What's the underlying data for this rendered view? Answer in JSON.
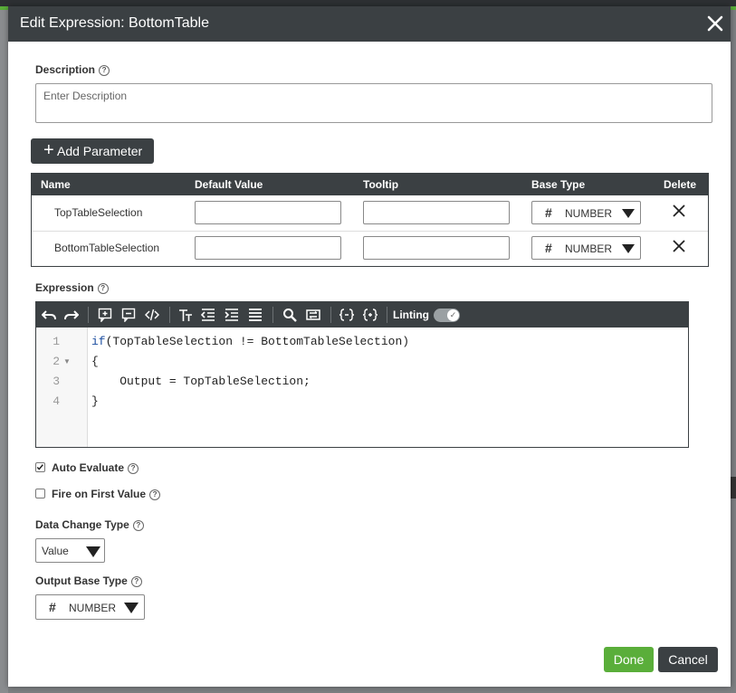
{
  "dialog": {
    "title": "Edit Expression: BottomTable"
  },
  "description": {
    "label": "Description",
    "placeholder": "Enter Description",
    "value": ""
  },
  "add_parameter_label": "Add Parameter",
  "parameters": {
    "columns": [
      "Name",
      "Default Value",
      "Tooltip",
      "Base Type",
      "Delete"
    ],
    "rows": [
      {
        "name": "TopTableSelection",
        "default_value": "",
        "tooltip": "",
        "base_type": "NUMBER"
      },
      {
        "name": "BottomTableSelection",
        "default_value": "",
        "tooltip": "",
        "base_type": "NUMBER"
      }
    ]
  },
  "expression": {
    "label": "Expression",
    "linting_label": "Linting",
    "linting_enabled": true,
    "line_numbers": [
      "1",
      "2",
      "3",
      "4"
    ],
    "code": {
      "line1_kw": "if",
      "line1_rest": "(TopTableSelection != BottomTableSelection)",
      "line2": "{",
      "line3": "    Output = TopTableSelection;",
      "line4": "}"
    }
  },
  "options": {
    "auto_evaluate": {
      "label": "Auto Evaluate",
      "checked": true
    },
    "fire_on_first_value": {
      "label": "Fire on First Value",
      "checked": false
    }
  },
  "data_change_type": {
    "label": "Data Change Type",
    "value": "Value"
  },
  "output_base_type": {
    "label": "Output Base Type",
    "value": "NUMBER"
  },
  "buttons": {
    "done": "Done",
    "cancel": "Cancel"
  },
  "colors": {
    "header": "#3b4043",
    "done": "#5aae3a"
  }
}
